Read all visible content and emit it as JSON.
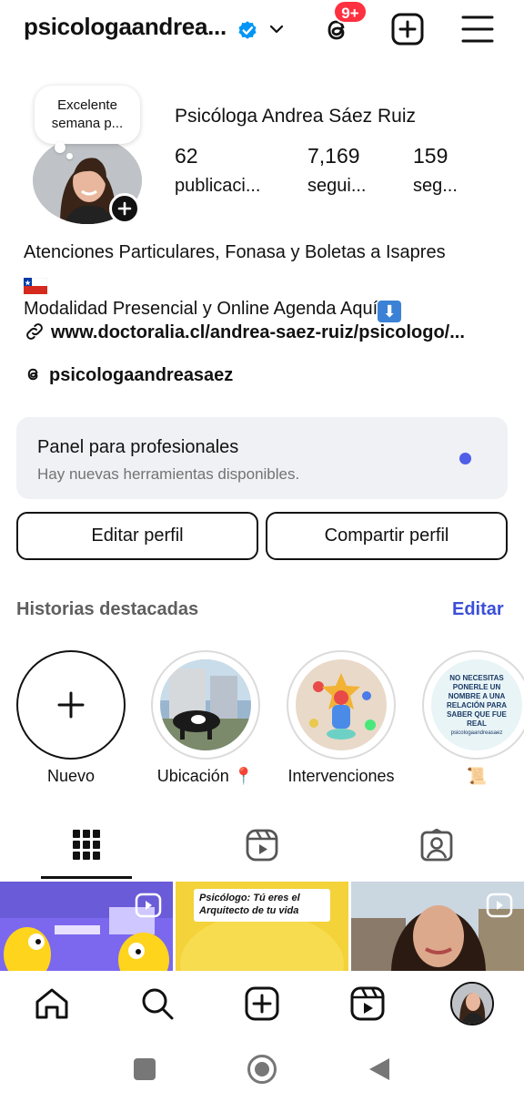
{
  "header": {
    "username": "psicologaandrea...",
    "notification_badge": "9+",
    "icons": [
      "verified-badge-icon",
      "chevron-down-icon",
      "threads-icon",
      "plus-square-icon",
      "hamburger-menu-icon"
    ]
  },
  "profile": {
    "note": "Excelente semana p...",
    "display_name": "Psicóloga Andrea Sáez  Ruiz",
    "stats": [
      {
        "value": "62",
        "label": "publicaci..."
      },
      {
        "value": "7,169",
        "label": "segui..."
      },
      {
        "value": "159",
        "label": "seg..."
      }
    ],
    "bio_line1": "Atenciones Particulares, Fonasa y Boletas a Isapres",
    "bio_line3": "Modalidad Presencial y Online Agenda Aquí",
    "link": "www.doctoralia.cl/andrea-saez-ruiz/psicologo/...",
    "threads_handle": "psicologaandreasaez"
  },
  "panel": {
    "title": "Panel para profesionales",
    "subtitle": "Hay nuevas herramientas disponibles."
  },
  "buttons": {
    "edit": "Editar perfil",
    "share": "Compartir perfil"
  },
  "highlights": {
    "title": "Historias destacadas",
    "edit": "Editar",
    "items": [
      {
        "label": "Nuevo"
      },
      {
        "label": "Ubicación 📍"
      },
      {
        "label": "Intervenciones"
      },
      {
        "label": "📜"
      }
    ],
    "rel_text": "NO NECESITAS PONERLE UN NOMBRE A UNA RELACIÓN PARA SABER QUE FUE REAL",
    "rel_handle": "psicologaandreasaez"
  },
  "grid": {
    "post2_text": "Psicólogo: Tú eres el Arquitecto de tu vida"
  },
  "colors": {
    "accent": "#3b4fd8",
    "badge": "#ff3040",
    "panel_bg": "#eff1f5",
    "panel_dot": "#4f5de8"
  }
}
